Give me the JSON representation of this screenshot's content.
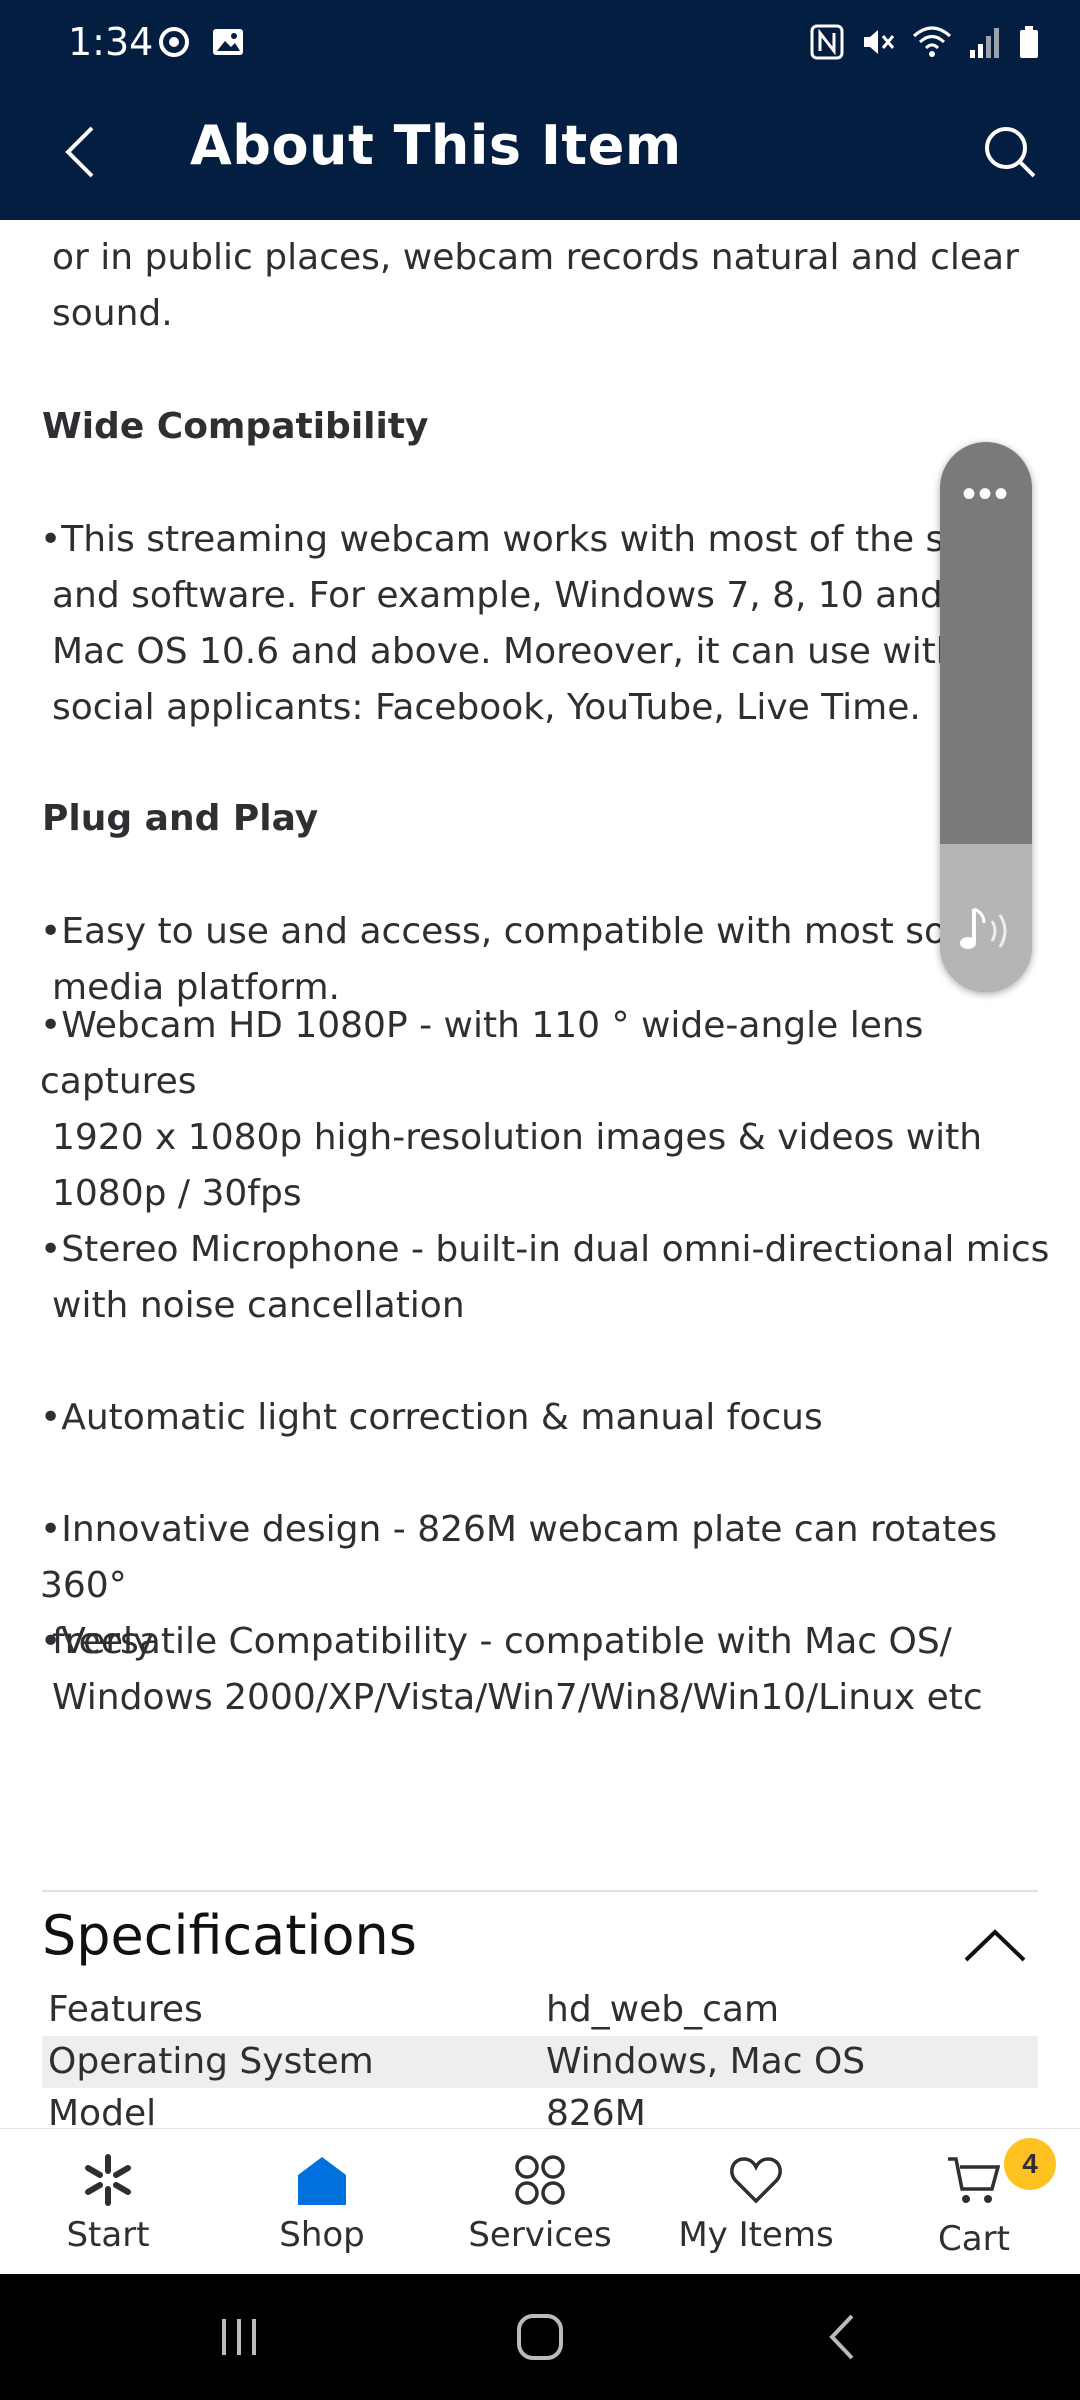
{
  "status_bar": {
    "time": "1:34"
  },
  "header": {
    "title": "About This Item"
  },
  "content": {
    "intro": [
      "or in public places, webcam records natural and clear",
      "sound."
    ],
    "section1": {
      "heading": "Wide Compatibility",
      "lines": [
        "•This streaming webcam works with most of the syste",
        "and software. For example, Windows 7, 8, 10 and abo",
        "Mac OS 10.6 and above. Moreover, it can use with m",
        "social applicants: Facebook, YouTube, Live Time."
      ]
    },
    "section2": {
      "heading": "Plug and Play",
      "lines": [
        "•Easy to use and access, compatible with most social",
        "media platform."
      ]
    },
    "bullets": [
      [
        "•Webcam HD 1080P - with 110 ° wide-angle lens captures",
        "1920 x 1080p high-resolution images & videos with",
        "1080p / 30fps"
      ],
      [
        "•Stereo Microphone - built-in dual omni-directional mics",
        "with noise cancellation"
      ],
      [
        "•Automatic light correction & manual focus"
      ],
      [
        "•Innovative design - 826M webcam plate can rotates 360°",
        "freely"
      ],
      [
        "•Versatile Compatibility - compatible with Mac OS/",
        "Windows 2000/XP/Vista/Win7/Win8/Win10/Linux etc"
      ]
    ]
  },
  "specifications": {
    "title": "Specifications",
    "rows": [
      {
        "key": "Features",
        "value": "hd_web_cam"
      },
      {
        "key": "Operating System",
        "value": "Windows, Mac OS"
      },
      {
        "key": "Model",
        "value": "826M"
      }
    ]
  },
  "floating_widget": {
    "menu": "•••"
  },
  "bottom_nav": {
    "items": [
      {
        "label": "Start",
        "icon": "spark-icon"
      },
      {
        "label": "Shop",
        "icon": "shop-icon",
        "active": true
      },
      {
        "label": "Services",
        "icon": "services-icon"
      },
      {
        "label": "My Items",
        "icon": "heart-icon"
      },
      {
        "label": "Cart",
        "icon": "cart-icon"
      }
    ],
    "cart_count": "4"
  },
  "colors": {
    "header_bg": "#041e42",
    "active_blue": "#0071dc",
    "badge_yellow": "#ffc220"
  }
}
